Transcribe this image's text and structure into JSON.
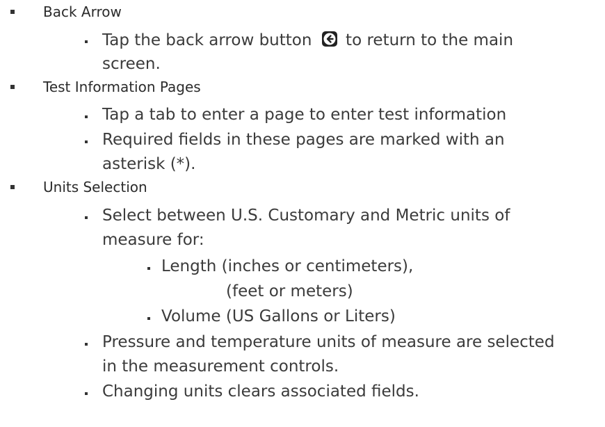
{
  "sections": [
    {
      "heading": "Back Arrow",
      "items": [
        {
          "text_before": "Tap the back arrow button ",
          "icon": "back-arrow-circle-icon",
          "text_after": " to return to the main",
          "continuation": "screen."
        }
      ]
    },
    {
      "heading": "Test Information Pages",
      "items": [
        {
          "text": "Tap a tab to enter a page to enter test information"
        },
        {
          "text": "Required fields in these pages are marked with an",
          "continuation": "asterisk (*)."
        }
      ]
    },
    {
      "heading": "Units Selection",
      "items": [
        {
          "text": "Select between U.S. Customary and Metric units of",
          "continuation": "measure for:",
          "subitems": [
            {
              "text": "Length  (inches or centimeters),",
              "continuation": "(feet or meters)"
            },
            {
              "text": "Volume (US Gallons or Liters)"
            }
          ]
        },
        {
          "text": "Pressure and temperature units of measure are selected",
          "continuation": " in the measurement controls."
        },
        {
          "text": "Changing units clears associated fields."
        }
      ]
    }
  ]
}
